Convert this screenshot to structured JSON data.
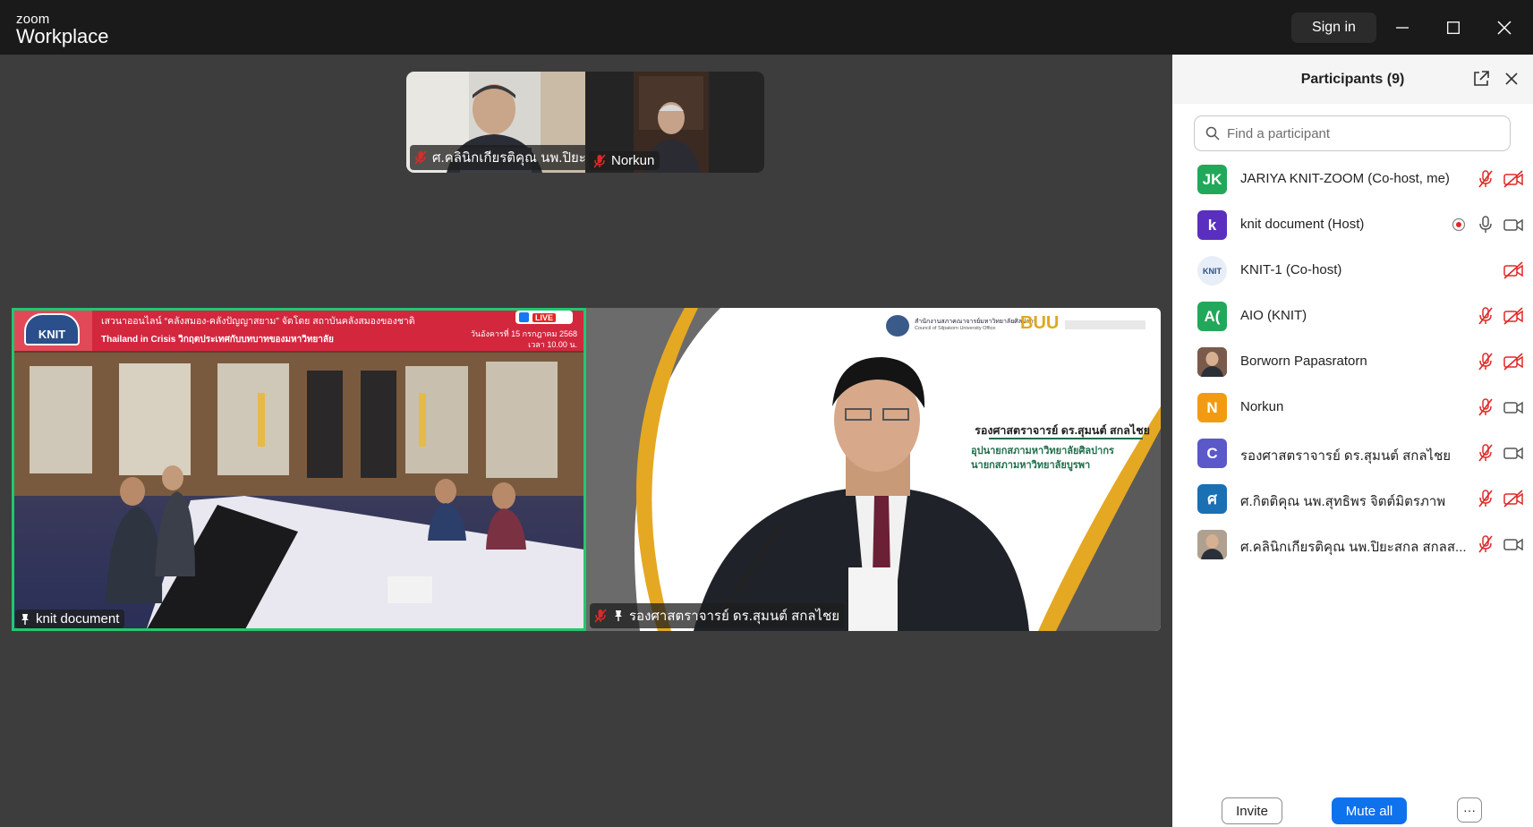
{
  "titlebar": {
    "brand_small": "zoom",
    "brand_large": "Workplace",
    "sign_in": "Sign in"
  },
  "thumbnails": [
    {
      "name": "ศ.คลินิกเกียรติคุณ นพ.ปิยะ...",
      "muted": true
    },
    {
      "name": "Norkun",
      "muted": true
    }
  ],
  "main_tiles": [
    {
      "name": "knit document",
      "pinned": true,
      "active": true,
      "banner": {
        "logo": "KNIT",
        "line1": "เสวนาออนไลน์ “คลังสมอง-คลังปัญญาสยาม” จัดโดย สถาบันคลังสมองของชาติ",
        "line2": "Thailand in Crisis  วิกฤตประเทศกับบทบาทของมหาวิทยาลัย",
        "date": "วันอังคารที่ 15 กรกฎาคม 2568",
        "time": "เวลา 10.00 น.",
        "live": "LIVE"
      }
    },
    {
      "name": "รองศาสตราจารย์ ดร.สุมนต์ สกลไชย",
      "muted": true,
      "pinned": true,
      "slide": {
        "org": "สำนักงานสภาคณาจารย์มหาวิทยาลัยศิลปากร",
        "org_en": "Council of Silpakorn University Office",
        "buu": "BUU",
        "title_name": "รองศาสตราจารย์ ดร.สุมนต์ สกลไชย",
        "title_1": "อุปนายกสภามหาวิทยาลัยศิลปากร",
        "title_2": "นายกสภามหาวิทยาลัยบูรพา"
      }
    }
  ],
  "panel": {
    "title": "Participants (9)",
    "search_placeholder": "Find a participant",
    "participants": [
      {
        "initials": "JK",
        "name": "JARIYA KNIT-ZOOM (Co-host, me)",
        "color": "#22a85a",
        "icons": [
          "mic-muted",
          "video-off"
        ]
      },
      {
        "initials": "k",
        "name": "knit document (Host)",
        "color": "#5a2fbf",
        "icons": [
          "record",
          "mic",
          "video"
        ]
      },
      {
        "initials": "KNIT",
        "name": "KNIT-1 (Co-host)",
        "color": "#e8eef7",
        "icons": [
          "video-off"
        ]
      },
      {
        "initials": "A(",
        "name": "AIO (KNIT)",
        "color": "#22a85a",
        "icons": [
          "mic-muted",
          "video-off"
        ]
      },
      {
        "initials": "",
        "name": "Borworn Papasratorn",
        "color": "#7a5a4a",
        "icons": [
          "mic-muted",
          "video-off"
        ]
      },
      {
        "initials": "N",
        "name": "Norkun",
        "color": "#f29b12",
        "icons": [
          "mic-muted",
          "video"
        ]
      },
      {
        "initials": "C",
        "name": "รองศาสตราจารย์ ดร.สุมนต์ สกลไชย",
        "color": "#5b58c9",
        "icons": [
          "mic-muted",
          "video"
        ]
      },
      {
        "initials": "ศ",
        "name": "ศ.กิตติคุณ นพ.สุทธิพร  จิตต์มิตรภาพ",
        "color": "#1b6fb3",
        "icons": [
          "mic-muted",
          "video-off"
        ]
      },
      {
        "initials": "",
        "name": "ศ.คลินิกเกียรติคุณ นพ.ปิยะสกล  สกลส...",
        "color": "#b0a090",
        "icons": [
          "mic-muted",
          "video"
        ]
      }
    ],
    "invite": "Invite",
    "mute_all": "Mute all",
    "more": "···"
  }
}
